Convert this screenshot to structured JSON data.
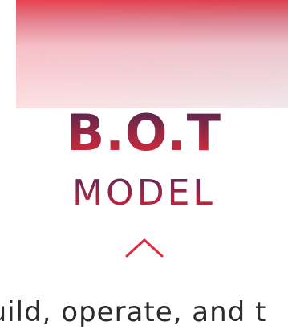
{
  "hero": {
    "title": "B.O.T",
    "subtitle": "MODEL",
    "description_partial": "uild, operate, and t"
  },
  "colors": {
    "accent_red": "#e02a39",
    "accent_plum": "#53264f",
    "text_dark": "#2e2b2c"
  },
  "icons": {
    "chevron": "chevron-up-icon"
  }
}
